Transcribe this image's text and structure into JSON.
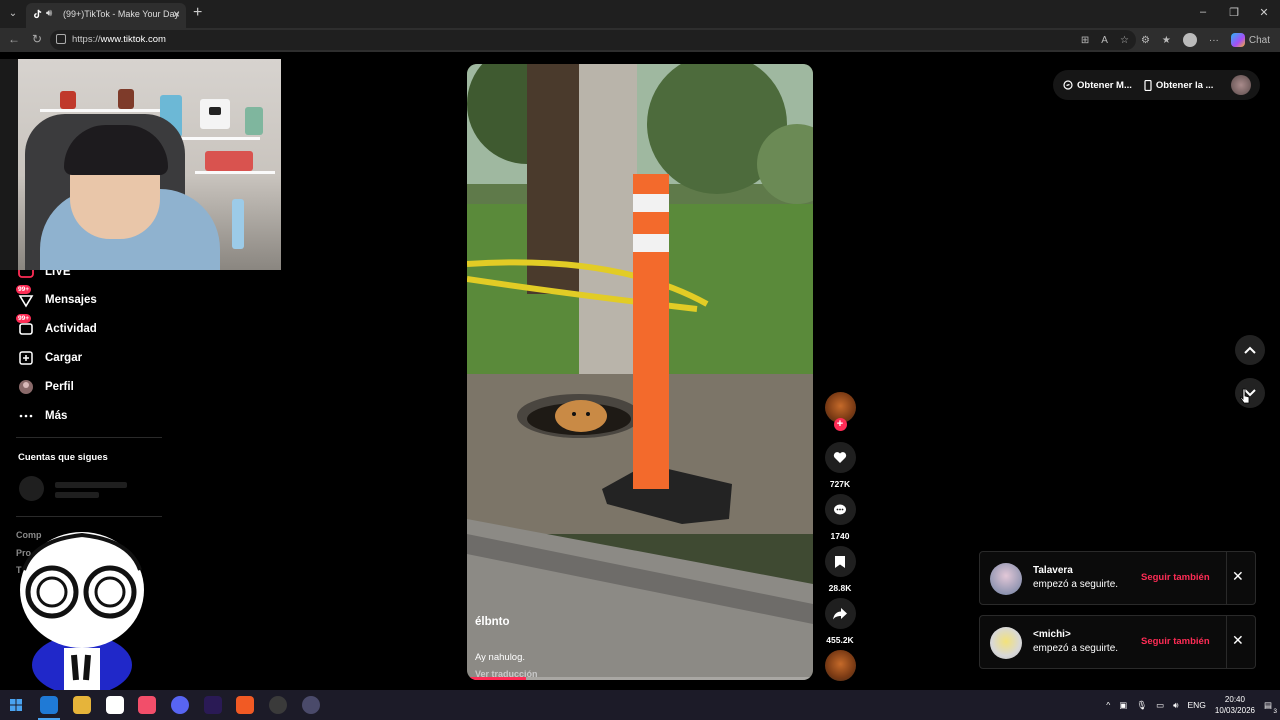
{
  "browser": {
    "tab_title": "(99+)TikTok - Make Your Day",
    "url_scheme": "https://",
    "url_host": "www.tiktok.com",
    "chat_label": "Chat"
  },
  "sidebar": {
    "items": [
      {
        "label": "LIVE",
        "icon": "live-icon"
      },
      {
        "label": "Mensajes",
        "icon": "messages-icon",
        "badge": "99+"
      },
      {
        "label": "Actividad",
        "icon": "activity-icon",
        "badge": "99+"
      },
      {
        "label": "Cargar",
        "icon": "upload-icon"
      },
      {
        "label": "Perfil",
        "icon": "profile-icon"
      },
      {
        "label": "Más",
        "icon": "more-icon"
      }
    ],
    "following_title": "Cuentas que sigues",
    "footer_peek": [
      "Comp",
      "Pro",
      "T"
    ]
  },
  "video": {
    "author": "élbnto",
    "caption": "Ay nahulog.",
    "translate_label": "Ver traducción",
    "progress": 0.17
  },
  "actions": {
    "likes": "727K",
    "comments": "1740",
    "saves": "28.8K",
    "shares": "455.2K"
  },
  "topright": {
    "coins_label": "Obtener M...",
    "app_label": "Obtener la ..."
  },
  "notifications": [
    {
      "name": "Talavera",
      "text": "empezó a seguirte.",
      "action": "Seguir también"
    },
    {
      "name": "<michi>",
      "text": "empezó a seguirte.",
      "action": "Seguir también"
    }
  ],
  "taskbar": {
    "lang": "ENG",
    "time": "20:40",
    "date": "10/03/2026",
    "notif_count": "3"
  },
  "colors": {
    "accent": "#fe2c55",
    "background": "#000000"
  }
}
